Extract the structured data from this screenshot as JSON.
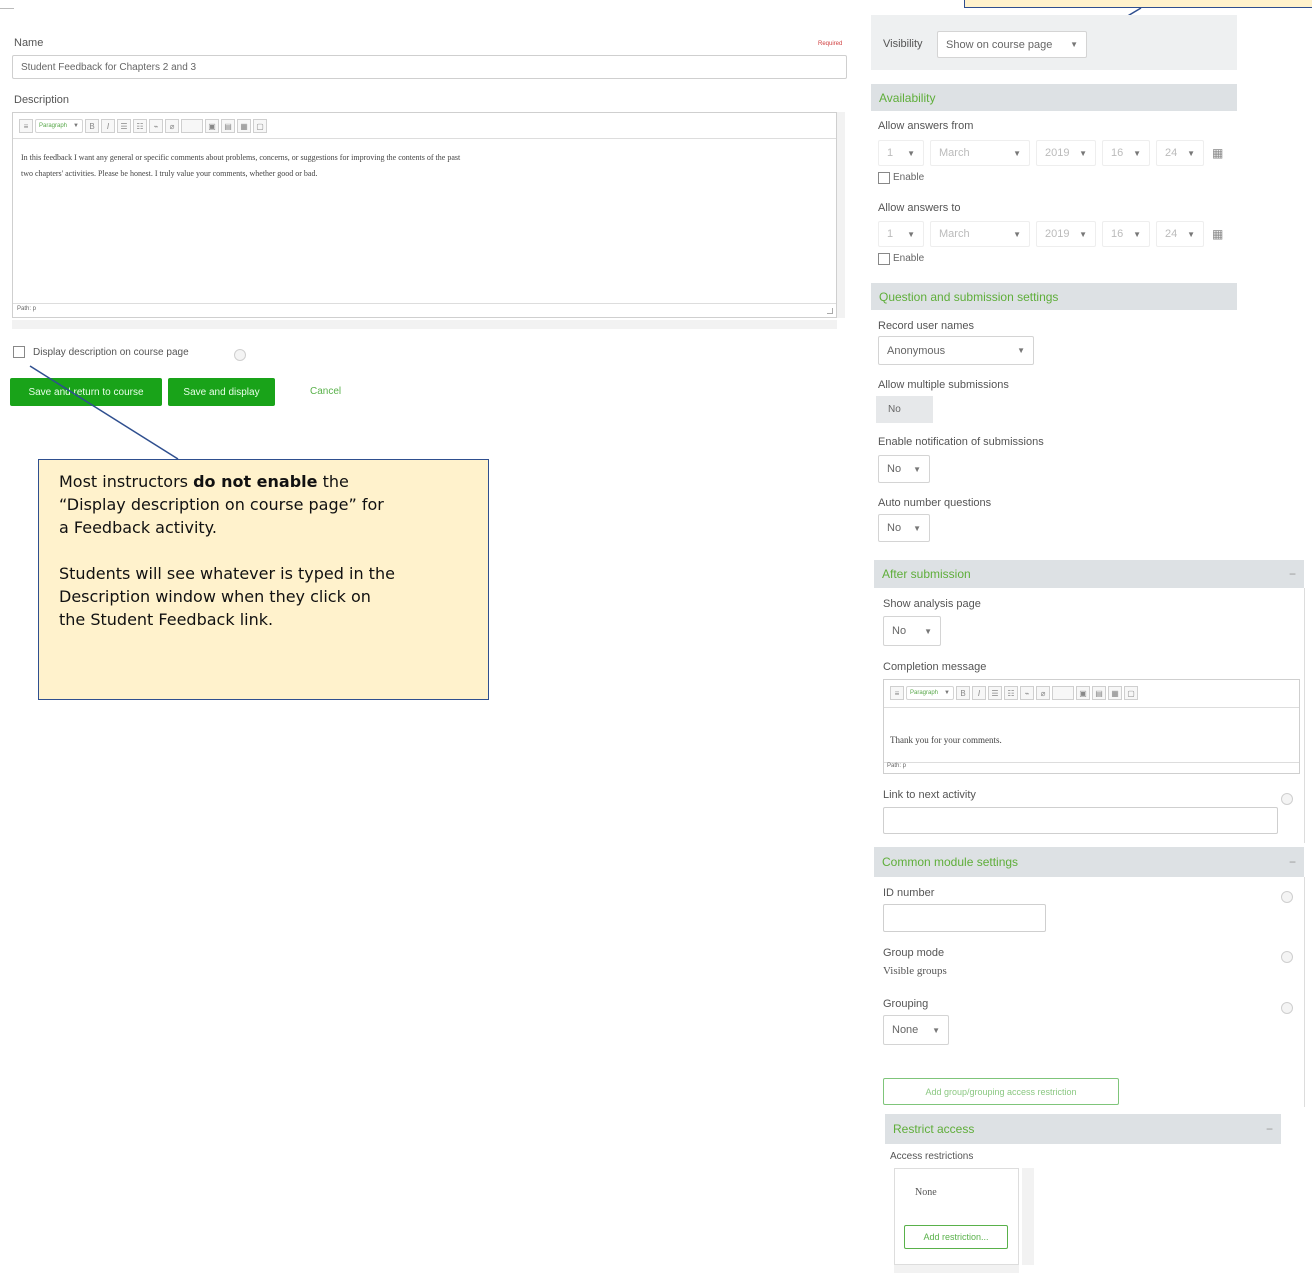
{
  "left": {
    "name_label": "Name",
    "required_label": "Required",
    "name_value": "Student Feedback for Chapters 2 and 3",
    "description_label": "Description",
    "format_select": "Paragraph",
    "description_text_1": "In this feedback I want any general or specific comments about problems, concerns, or suggestions for improving the contents of the past",
    "description_text_2": "two chapters' activities. Please be honest. I truly value your comments, whether good or bad.",
    "path_label": "Path: p",
    "display_description_label": "Display description on course page",
    "save_return_label": "Save and return to course",
    "save_display_label": "Save and display",
    "cancel_label": "Cancel"
  },
  "callout_bottom": {
    "line1_a": "Most instructors ",
    "line1_b": "do not enable",
    "line1_c": " the",
    "line2": "“Display description on course page” for",
    "line3": "a Feedback activity.",
    "line4": "Students will see whatever is typed in the",
    "line5": "Description window when they click on",
    "line6": "the Student Feedback link."
  },
  "right": {
    "visibility_label": "Visibility",
    "visibility_value": "Show on course page",
    "availability_header": "Availability",
    "allow_from_label": "Allow answers from",
    "allow_to_label": "Allow answers to",
    "date_day": "1",
    "date_month": "March",
    "date_year": "2019",
    "date_hour": "16",
    "date_minute": "24",
    "enable_label": "Enable",
    "question_header": "Question and submission settings",
    "record_names_label": "Record user names",
    "record_names_value": "Anonymous",
    "multiple_submissions_label": "Allow multiple submissions",
    "multiple_submissions_value": "No",
    "notification_label": "Enable notification of submissions",
    "notification_value": "No",
    "auto_number_label": "Auto number questions",
    "auto_number_value": "No",
    "after_header": "After submission",
    "show_analysis_label": "Show analysis page",
    "show_analysis_value": "No",
    "completion_label": "Completion message",
    "completion_format": "Paragraph",
    "completion_text": "Thank you for your comments.",
    "completion_path": "Path: p",
    "link_next_label": "Link to next activity",
    "common_header": "Common module settings",
    "id_number_label": "ID number",
    "group_mode_label": "Group mode",
    "group_mode_value": "Visible groups",
    "grouping_label": "Grouping",
    "grouping_value": "None",
    "add_group_restriction_label": "Add group/grouping access restriction",
    "restrict_header": "Restrict access",
    "access_restrictions_label": "Access restrictions",
    "access_none": "None",
    "add_restriction_label": "Add restriction..."
  },
  "colors": {
    "accent_green": "#19a319",
    "section_text_green": "#5fae3a",
    "callout_bg": "#fff2cc",
    "callout_border": "#2f4f8f"
  }
}
